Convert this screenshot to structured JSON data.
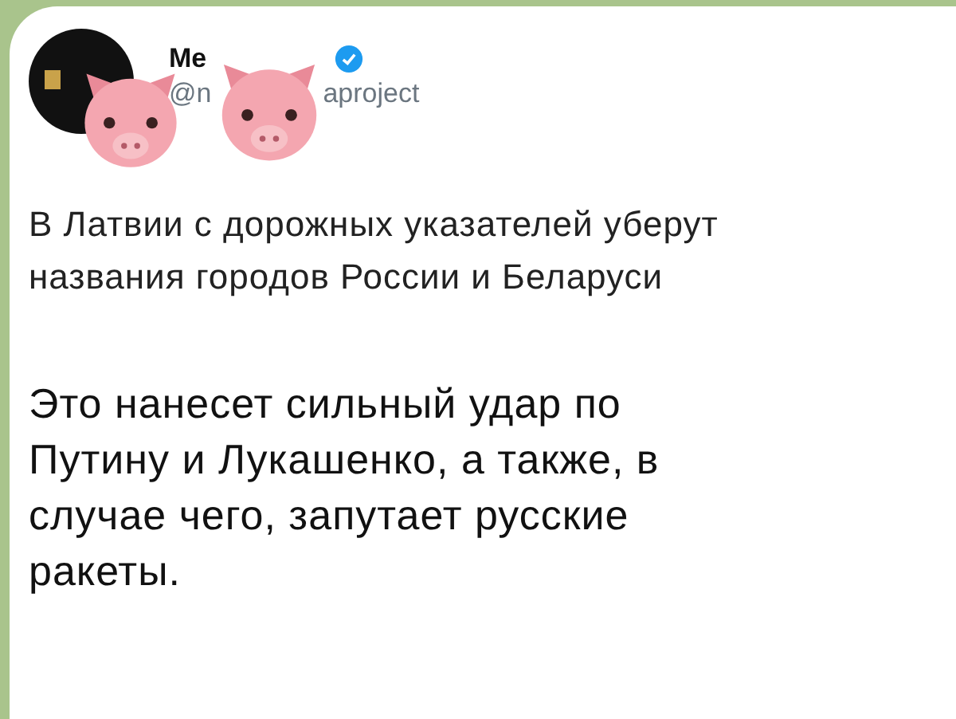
{
  "post": {
    "author_name": "Me",
    "handle_start": "@n",
    "handle_end": "aproject",
    "verified": true,
    "headline": "В Латвии с дорожных указателей уберут названия городов России и Беларуси",
    "comment": "Это нанесет сильный удар по Путину и Лукашенко, а также, в случае чего, запутает русские ракеты."
  }
}
